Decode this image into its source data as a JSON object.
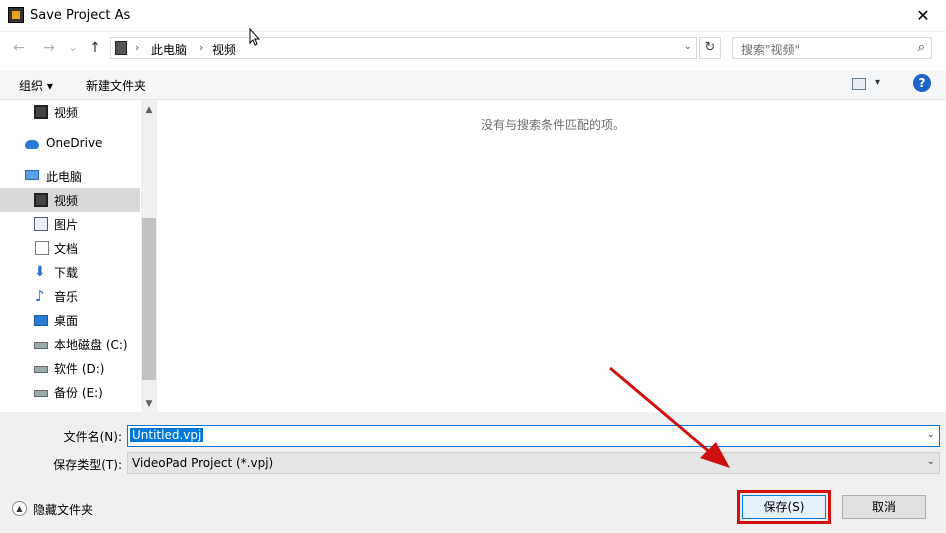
{
  "window": {
    "title": "Save Project As",
    "close_glyph": "✕"
  },
  "nav": {
    "back_glyph": "←",
    "forward_glyph": "→",
    "recent_glyph": "⌄",
    "up_glyph": "↑",
    "breadcrumb": [
      "此电脑",
      "视频"
    ],
    "crumb_sep": "›",
    "refresh_glyph": "↻",
    "search_placeholder": "搜索\"视频\"",
    "search_glyph": "⌕"
  },
  "toolbar": {
    "organize_label": "组织 ▾",
    "new_folder_label": "新建文件夹",
    "view_drop": "▾",
    "help_glyph": "?"
  },
  "sidebar": {
    "items": [
      {
        "label": "视频",
        "icon": "film-icon",
        "selected": false
      },
      {
        "label": "OneDrive",
        "icon": "cloud-icon",
        "selected": false
      },
      {
        "label": "此电脑",
        "icon": "computer-icon",
        "selected": false
      },
      {
        "label": "视频",
        "icon": "film-icon",
        "selected": true
      },
      {
        "label": "图片",
        "icon": "picture-icon",
        "selected": false
      },
      {
        "label": "文档",
        "icon": "document-icon",
        "selected": false
      },
      {
        "label": "下载",
        "icon": "download-icon",
        "selected": false
      },
      {
        "label": "音乐",
        "icon": "music-icon",
        "selected": false
      },
      {
        "label": "桌面",
        "icon": "desktop-icon",
        "selected": false
      },
      {
        "label": "本地磁盘 (C:)",
        "icon": "drive-icon",
        "selected": false
      },
      {
        "label": "软件 (D:)",
        "icon": "drive-icon",
        "selected": false
      },
      {
        "label": "备份 (E:)",
        "icon": "drive-icon",
        "selected": false
      }
    ]
  },
  "content": {
    "empty_message": "没有与搜索条件匹配的项。"
  },
  "form": {
    "filename_label": "文件名(N):",
    "filename_value": "Untitled.vpj",
    "filetype_label": "保存类型(T):",
    "filetype_value": "VideoPad Project (*.vpj)",
    "combo_drop": "⌄"
  },
  "footer": {
    "hide_folders_label": "隐藏文件夹",
    "hide_glyph": "▲",
    "save_label": "保存(S)",
    "cancel_label": "取消"
  },
  "colors": {
    "accent": "#0078d7",
    "highlight": "#d01010",
    "selected_row": "#d9d9d9"
  }
}
